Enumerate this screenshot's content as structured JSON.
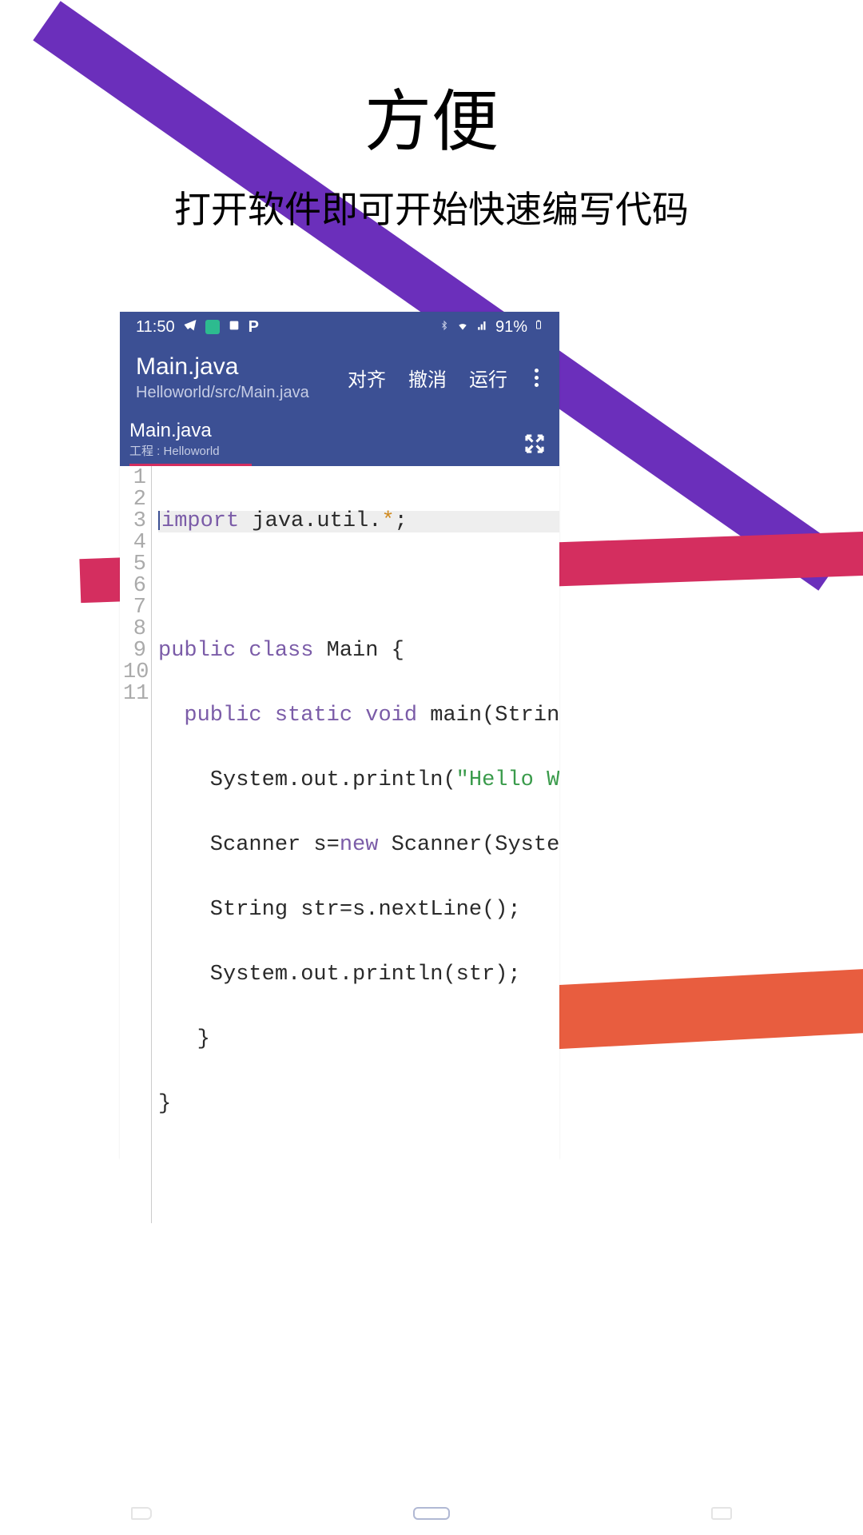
{
  "headline": {
    "title": "方便",
    "subtitle": "打开软件即可开始快速编写代码"
  },
  "statusbar": {
    "time": "11:50",
    "battery": "91%"
  },
  "appbar": {
    "title": "Main.java",
    "path": "Helloworld/src/Main.java",
    "actions": {
      "align": "对齐",
      "undo": "撤消",
      "run": "运行"
    }
  },
  "tab": {
    "label": "Main.java",
    "project_prefix": "工程 : ",
    "project_name": "Helloworld"
  },
  "code": {
    "lines": [
      "1",
      "2",
      "3",
      "4",
      "5",
      "6",
      "7",
      "8",
      "9",
      "10",
      "11"
    ],
    "l1": {
      "kw": "import",
      "rest": " java.util.",
      "star": "*",
      "semi": ";"
    },
    "l3": {
      "kw1": "public",
      "kw2": "class",
      "name": " Main {"
    },
    "l4": {
      "kw1": "public",
      "kw2": "static",
      "kw3": "void",
      "rest": " main(String[]"
    },
    "l5": {
      "pre": "    System.out.println(",
      "str": "\"Hello World"
    },
    "l6": {
      "pre": "    Scanner s=",
      "kw": "new",
      "rest": " Scanner(System.in"
    },
    "l7": "    String str=s.nextLine();",
    "l8": "    System.out.println(str);",
    "l9": "   }",
    "l10": "}"
  }
}
